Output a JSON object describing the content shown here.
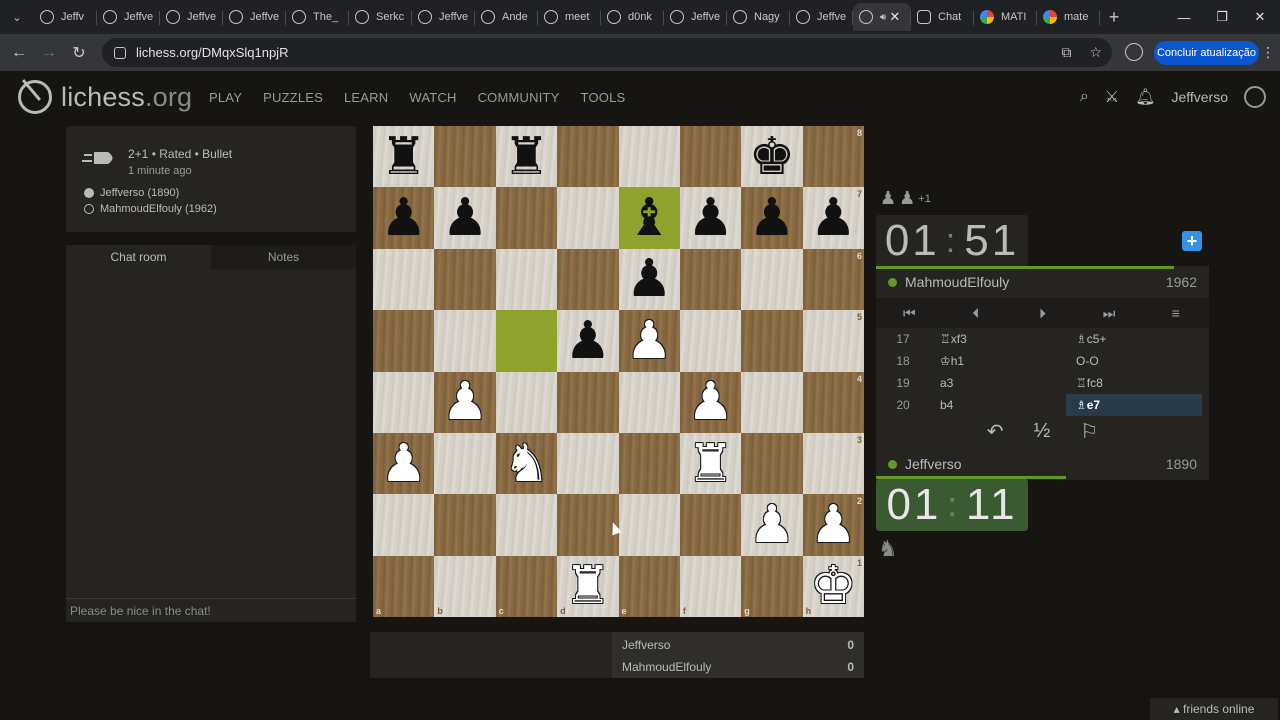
{
  "browser": {
    "tabs": [
      {
        "title": "Jeffv",
        "icon": "lichess"
      },
      {
        "title": "Jeffve",
        "icon": "lichess"
      },
      {
        "title": "Jeffve",
        "icon": "lichess"
      },
      {
        "title": "Jeffve",
        "icon": "lichess"
      },
      {
        "title": "The_",
        "icon": "lichess"
      },
      {
        "title": "Serkc",
        "icon": "lichess"
      },
      {
        "title": "Jeffve",
        "icon": "lichess"
      },
      {
        "title": "Ande",
        "icon": "lichess"
      },
      {
        "title": "meet",
        "icon": "lichess"
      },
      {
        "title": "d0nk",
        "icon": "lichess"
      },
      {
        "title": "Jeffve",
        "icon": "lichess"
      },
      {
        "title": "Nagy",
        "icon": "lichess"
      },
      {
        "title": "Jeffve",
        "icon": "lichess"
      }
    ],
    "active_tab_close": "✕",
    "tabs_after": [
      {
        "title": "Chat",
        "icon": "chatgpt"
      },
      {
        "title": "MATI",
        "icon": "google"
      },
      {
        "title": "mate",
        "icon": "google"
      }
    ],
    "url": "lichess.org/DMqxSlq1npjR",
    "update_button": "Concluir atualização"
  },
  "site": {
    "logo_main": "lichess",
    "logo_tld": ".org",
    "nav": [
      "PLAY",
      "PUZZLES",
      "LEARN",
      "WATCH",
      "COMMUNITY",
      "TOOLS"
    ],
    "username": "Jeffverso"
  },
  "game_info": {
    "meta": "2+1 • Rated • Bullet",
    "time": "1 minute ago",
    "white": "Jeffverso (1890)",
    "black": "MahmoudElfouly (1962)"
  },
  "chat": {
    "tab_chat": "Chat room",
    "tab_notes": "Notes",
    "placeholder": "Please be nice in the chat!"
  },
  "board": {
    "rank_labels": [
      "8",
      "7",
      "6",
      "5",
      "4",
      "3",
      "2",
      "1"
    ],
    "file_labels": [
      "a",
      "b",
      "c",
      "d",
      "e",
      "f",
      "g",
      "h"
    ],
    "highlight_squares": [
      "e7",
      "c5"
    ],
    "position": [
      [
        "r",
        "",
        "r",
        "",
        "",
        "",
        "k",
        ""
      ],
      [
        "p",
        "p",
        "",
        "",
        "b",
        "p",
        "p",
        "p"
      ],
      [
        "",
        "",
        "",
        "",
        "p",
        "",
        "",
        ""
      ],
      [
        "",
        "",
        "",
        "p",
        "P",
        "",
        "",
        ""
      ],
      [
        "",
        "P",
        "",
        "",
        "",
        "P",
        "",
        ""
      ],
      [
        "P",
        "",
        "N",
        "",
        "",
        "R",
        "",
        ""
      ],
      [
        "",
        "",
        "",
        "",
        "",
        "",
        "P",
        "P"
      ],
      [
        "",
        "",
        "",
        "R",
        "",
        "",
        "",
        "K"
      ]
    ]
  },
  "right_panel": {
    "material_diff": "+1",
    "opponent_clock_min": "01",
    "opponent_clock_sec": "51",
    "opponent_name": "MahmoudElfouly",
    "opponent_rating": "1962",
    "player_clock_min": "01",
    "player_clock_sec": "11",
    "player_name": "Jeffverso",
    "player_rating": "1890",
    "moves": [
      {
        "n": "17",
        "w": "♖xf3",
        "b": "♗c5+"
      },
      {
        "n": "18",
        "w": "♔h1",
        "b": "O-O"
      },
      {
        "n": "19",
        "w": "a3",
        "b": "♖fc8"
      },
      {
        "n": "20",
        "w": "b4",
        "b": "♗e7"
      }
    ],
    "draw_symbol": "½"
  },
  "score": {
    "p1": "Jeffverso",
    "p1_score": "0",
    "p2": "MahmoudElfouly",
    "p2_score": "0"
  },
  "friends": "friends online",
  "colors": {
    "accent_green": "#629924",
    "highlight": "#a9b83a",
    "update_blue": "#0b57d0"
  }
}
